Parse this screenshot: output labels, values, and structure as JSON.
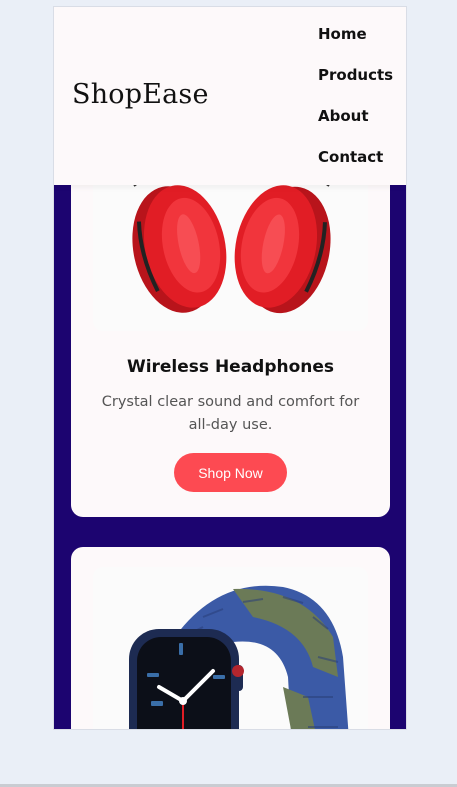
{
  "header": {
    "logo": "ShopEase",
    "nav": [
      "Home",
      "Products",
      "About",
      "Contact"
    ]
  },
  "products": [
    {
      "title": "Wireless Headphones",
      "description": "Crystal clear sound and comfort for all-day use.",
      "button": "Shop Now",
      "image_icon": "headphones-icon"
    },
    {
      "image_icon": "smartwatch-icon"
    }
  ],
  "colors": {
    "page_background": "#eaeff7",
    "section_background": "#1c0470",
    "card_background": "#fdf9fa",
    "button": "#fd4a52",
    "headphones": "#e11d25",
    "watch_band_blue": "#3b5aa6",
    "watch_band_olive": "#6b7a57"
  }
}
